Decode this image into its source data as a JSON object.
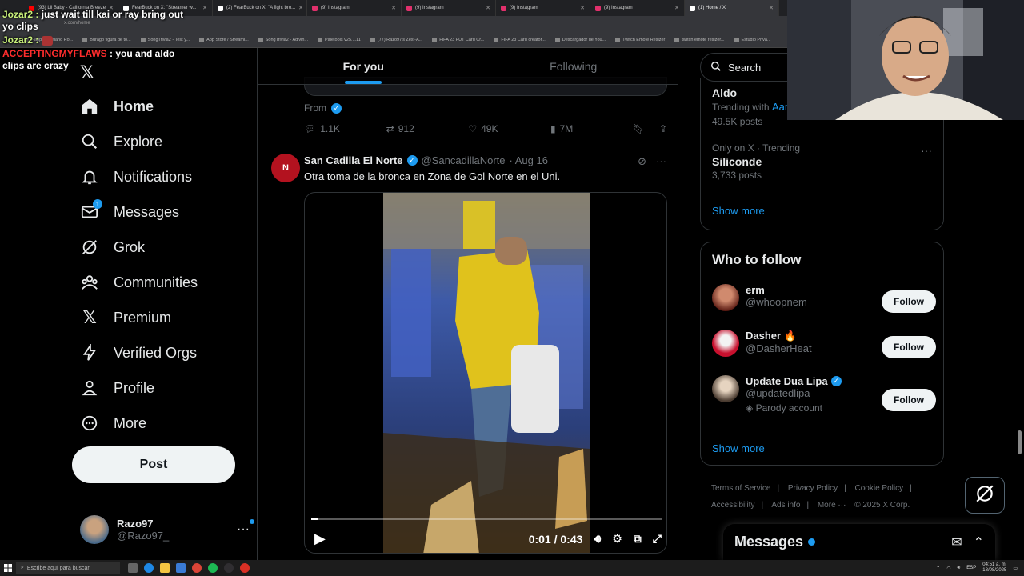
{
  "browser": {
    "tabs": [
      {
        "label": "(93) Lil Baby - California Breeze",
        "icon": "youtube-icon",
        "color": "#ff0000"
      },
      {
        "label": "FearBuck on X: \"Streamer w...",
        "icon": "x-icon",
        "color": "#ffffff"
      },
      {
        "label": "(2) FearBuck on X: \"A fight bro...",
        "icon": "x-icon",
        "color": "#ffffff"
      },
      {
        "label": "(9) Instagram",
        "icon": "instagram-icon",
        "color": "#e1306c"
      },
      {
        "label": "(9) Instagram",
        "icon": "instagram-icon",
        "color": "#e1306c"
      },
      {
        "label": "(9) Instagram",
        "icon": "instagram-icon",
        "color": "#e1306c"
      },
      {
        "label": "(9) Instagram",
        "icon": "instagram-icon",
        "color": "#e1306c"
      },
      {
        "label": "(1) Home / X",
        "icon": "x-icon",
        "color": "#ffffff",
        "active": true
      }
    ],
    "url": "x.com/home",
    "bookmarks": [
      "Happy Cristiano Ro...",
      "Burago figura de to...",
      "SongTrivia2 - Test y...",
      "App Store / Streami...",
      "SongTrivia2 - Adivin...",
      "Paletools v25.1.11",
      "(77) Razo97's Zest-A...",
      "FIFA 23 FUT Card Cr...",
      "FIFA 23 Card creator...",
      "Descargador de You...",
      "Twitch Emote Resizer",
      "twitch emote resizer...",
      "Estudio Priva..."
    ]
  },
  "chat": {
    "line1_user": "Jozar2 :",
    "line1_msg": "just wait till kai or ray bring out yo clips",
    "line2_user": "Jozar2 :",
    "line3_user": "ACCEPTINGMYFLAWS",
    "line3_msg": ": you and aldo clips are crazy"
  },
  "nav": {
    "items": [
      {
        "label": "Home",
        "icon": "home-icon"
      },
      {
        "label": "Explore",
        "icon": "search-icon"
      },
      {
        "label": "Notifications",
        "icon": "bell-icon"
      },
      {
        "label": "Messages",
        "icon": "envelope-icon",
        "badge": "1"
      },
      {
        "label": "Grok",
        "icon": "grok-icon"
      },
      {
        "label": "Communities",
        "icon": "people-icon"
      },
      {
        "label": "Premium",
        "icon": "x-logo-icon"
      },
      {
        "label": "Verified Orgs",
        "icon": "lightning-icon"
      },
      {
        "label": "Profile",
        "icon": "person-icon"
      },
      {
        "label": "More",
        "icon": "more-circle-icon"
      }
    ],
    "post_label": "Post",
    "account": {
      "name": "Razo97",
      "handle": "@Razo97_"
    }
  },
  "feed": {
    "tabs": [
      "For you",
      "Following"
    ],
    "prev_tweet": {
      "from_label": "From",
      "replies": "1.1K",
      "reposts": "912",
      "likes": "49K",
      "views": "7M"
    },
    "tweet": {
      "avatar_text": "N",
      "name": "San Cadilla El Norte",
      "handle": "@SancadillaNorte",
      "date": "· Aug 16",
      "text": "Otra toma de la bronca en Zona de Gol Norte en el Uni.",
      "video_time": "0:01 / 0:43",
      "video_progress": 0.02
    }
  },
  "right": {
    "search_placeholder": "Search",
    "trends": [
      {
        "name": "Aldo",
        "meta": "Trending with",
        "meta_link": "Aar",
        "posts": "49.5K posts"
      },
      {
        "meta": "Only on X · Trending",
        "name": "Siliconde",
        "posts": "3,733 posts"
      }
    ],
    "show_more": "Show more",
    "who_to_follow_title": "Who to follow",
    "follow_suggestions": [
      {
        "name": "erm",
        "handle": "@whoopnem",
        "extra": "",
        "badge": ""
      },
      {
        "name": "Dasher 🔥",
        "handle": "@DasherHeat",
        "extra": "",
        "badge": ""
      },
      {
        "name": "Update Dua Lipa",
        "handle": "@updatedlipa",
        "extra": "Parody account",
        "badge": "verified"
      }
    ],
    "follow_label": "Follow",
    "footer": [
      "Terms of Service",
      "|",
      "Privacy Policy",
      "|",
      "Cookie Policy",
      "|",
      "Accessibility",
      "|",
      "Ads info",
      "|",
      "More ···",
      "© 2025 X Corp."
    ],
    "messages_title": "Messages"
  },
  "taskbar": {
    "search_placeholder": "Escribe aquí para buscar",
    "time": "04:51 a. m.",
    "date": "18/08/2025",
    "lang": "ESP"
  },
  "colors": {
    "accent": "#1d9bf0",
    "bg": "#000000",
    "border": "#2f3336",
    "muted": "#71767b"
  }
}
